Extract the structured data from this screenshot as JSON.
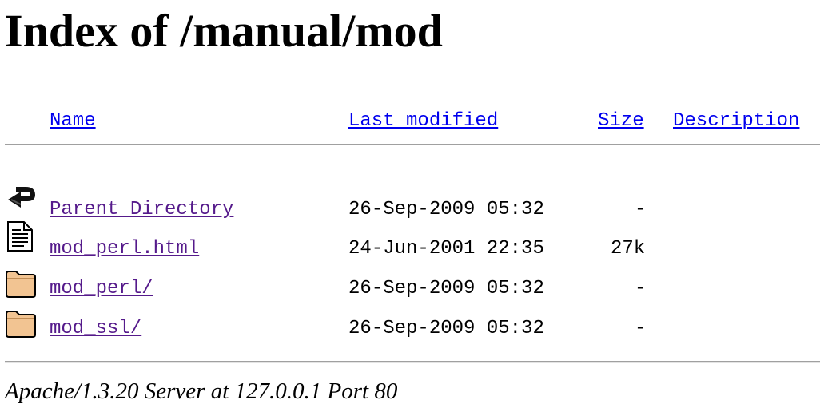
{
  "page": {
    "title": "Index of /manual/mod"
  },
  "columns": {
    "name": "Name",
    "last_modified": "Last modified",
    "size": "Size",
    "description": "Description"
  },
  "entries": [
    {
      "name": "Parent Directory",
      "modified": "26-Sep-2009 05:32",
      "size": "-",
      "icon": "back-arrow-icon"
    },
    {
      "name": "mod_perl.html",
      "modified": "24-Jun-2001 22:35",
      "size": "27k",
      "icon": "text-document-icon"
    },
    {
      "name": "mod_perl/",
      "modified": "26-Sep-2009 05:32",
      "size": "-",
      "icon": "folder-icon"
    },
    {
      "name": "mod_ssl/",
      "modified": "26-Sep-2009 05:32",
      "size": "-",
      "icon": "folder-icon"
    }
  ],
  "footer": {
    "signature": "Apache/1.3.20 Server at 127.0.0.1 Port 80"
  },
  "colors": {
    "link": "#0000ee",
    "visited_link": "#551a8b",
    "folder_fill": "#f2c492",
    "rule": "#a0a0a0"
  }
}
